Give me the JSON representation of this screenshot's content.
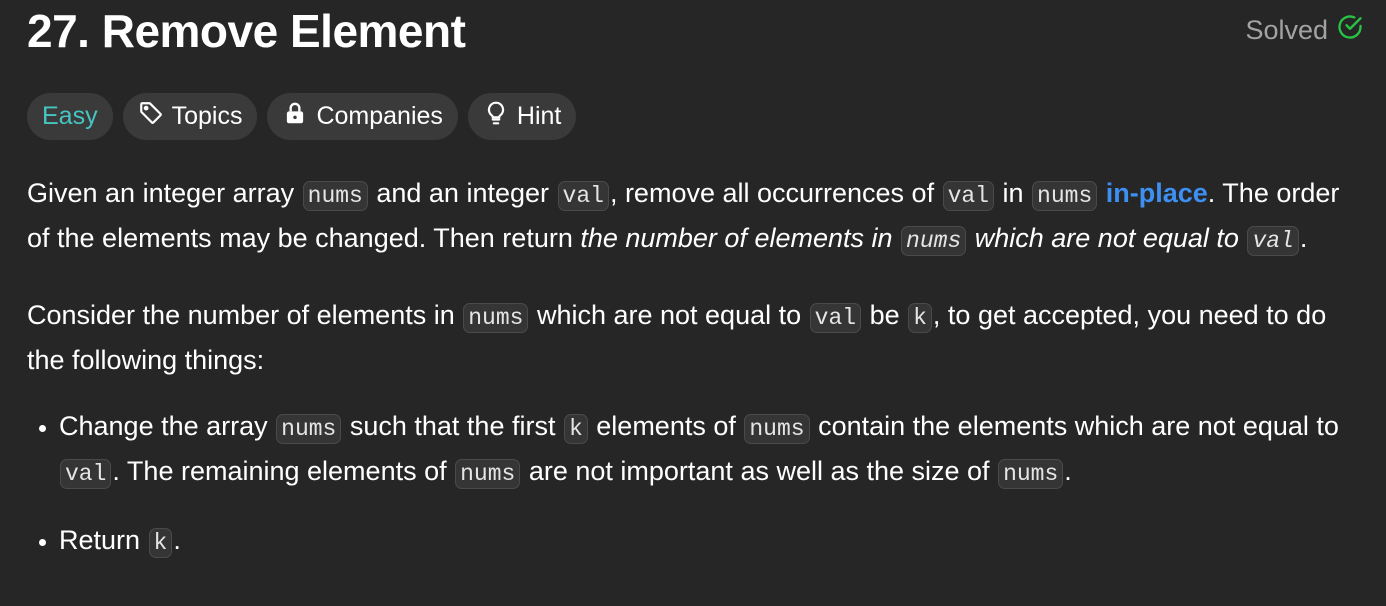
{
  "header": {
    "title": "27. Remove Element",
    "status_label": "Solved",
    "status_color": "#28c244"
  },
  "pills": {
    "difficulty": "Easy",
    "difficulty_color": "#46c6c2",
    "topics": "Topics",
    "companies": "Companies",
    "hint": "Hint"
  },
  "p1": {
    "t1": "Given an integer array ",
    "c1": "nums",
    "t2": " and an integer ",
    "c2": "val",
    "t3": ", remove all occurrences of ",
    "c3": "val",
    "t4": " in ",
    "c4": "nums",
    "t5": " ",
    "link": "in-place",
    "t6": ". The order of the elements may be changed. Then return ",
    "em1": "the number of elements in ",
    "c5": "nums",
    "em2": " which are not equal to ",
    "c6": "val",
    "t7": "."
  },
  "p2": {
    "t1": "Consider the number of elements in ",
    "c1": "nums",
    "t2": " which are not equal to ",
    "c2": "val",
    "t3": " be ",
    "c3": "k",
    "t4": ", to get accepted, you need to do the following things:"
  },
  "li1": {
    "t1": "Change the array ",
    "c1": "nums",
    "t2": " such that the first ",
    "c2": "k",
    "t3": " elements of ",
    "c3": "nums",
    "t4": " contain the elements which are not equal to ",
    "c4": "val",
    "t5": ". The remaining elements of ",
    "c5": "nums",
    "t6": " are not important as well as the size of ",
    "c6": "nums",
    "t7": "."
  },
  "li2": {
    "t1": "Return ",
    "c1": "k",
    "t2": "."
  }
}
